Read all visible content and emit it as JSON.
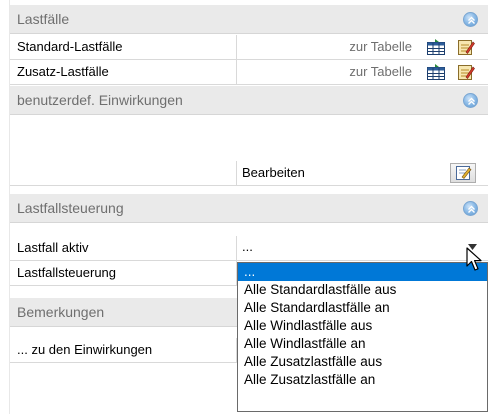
{
  "sections": {
    "lastfaelle": {
      "title": "Lastfälle",
      "rows": [
        {
          "label": "Standard-Lastfälle",
          "link": "zur Tabelle"
        },
        {
          "label": "Zusatz-Lastfälle",
          "link": "zur Tabelle"
        }
      ]
    },
    "einwirkungen": {
      "title": "benutzerdef. Einwirkungen",
      "button_text": "Bearbeiten"
    },
    "steuerung": {
      "title": "Lastfallsteuerung",
      "rows": [
        {
          "label": "Lastfall aktiv",
          "value": "..."
        },
        {
          "label": "Lastfallsteuerung"
        }
      ]
    },
    "bemerkungen": {
      "title": "Bemerkungen",
      "rows": [
        {
          "label": "... zu den Einwirkungen"
        }
      ]
    }
  },
  "dropdown": {
    "selected_index": 0,
    "options": [
      "...",
      "Alle Standardlastfälle aus",
      "Alle Standardlastfälle an",
      "Alle Windlastfälle aus",
      "Alle Windlastfälle an",
      "Alle Zusatzlastfälle aus",
      "Alle Zusatzlastfälle an"
    ]
  },
  "colors": {
    "header_bg": "#eaeaea",
    "header_text": "#6f6f6f",
    "selection": "#0078d7"
  },
  "icons": {
    "collapse": "chevron-up-circle-icon",
    "table": "table-icon",
    "edit": "notepad-edit-icon",
    "arrow": "dropdown-arrow-icon",
    "cursor": "mouse-cursor-icon"
  }
}
